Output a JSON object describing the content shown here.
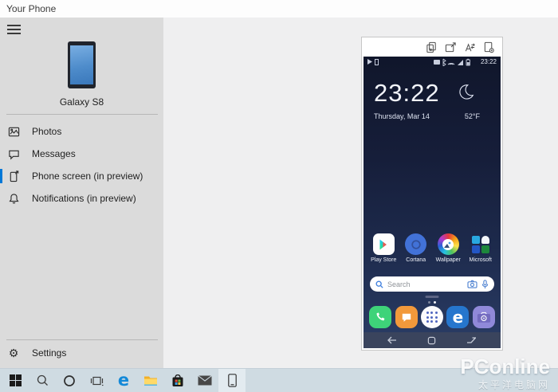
{
  "window": {
    "title": "Your Phone"
  },
  "sidebar": {
    "menu_icon": "hamburger-icon",
    "device": {
      "name": "Galaxy S8"
    },
    "items": [
      {
        "label": "Photos",
        "icon": "photos-icon",
        "selected": false
      },
      {
        "label": "Messages",
        "icon": "messages-icon",
        "selected": false
      },
      {
        "label": "Phone screen (in preview)",
        "icon": "phone-screen-icon",
        "selected": true
      },
      {
        "label": "Notifications (in preview)",
        "icon": "notifications-icon",
        "selected": false
      }
    ],
    "settings": {
      "label": "Settings",
      "icon": "gear-icon"
    }
  },
  "phone_mirror": {
    "toolbar_icons": [
      "copy-screens-icon",
      "open-window-icon",
      "text-input-icon",
      "screenshot-icon"
    ],
    "status_bar": {
      "time": "23:22",
      "left_icons": [
        "play-icon",
        "device-icon"
      ],
      "right_icons": [
        "cast-icon",
        "bluetooth-icon",
        "wifi-icon",
        "signal-icon",
        "battery-icon"
      ]
    },
    "clock_widget": {
      "time": "23:22",
      "date": "Thursday, Mar 14",
      "temperature": "52°F",
      "weather_icon": "crescent-moon-icon"
    },
    "home_apps": [
      {
        "label": "Play Store",
        "icon": "play-store-icon"
      },
      {
        "label": "Cortana",
        "icon": "cortana-icon"
      },
      {
        "label": "Wallpaper",
        "icon": "wallpaper-icon"
      },
      {
        "label": "Microsoft",
        "icon": "microsoft-folder-icon"
      }
    ],
    "search_bar": {
      "placeholder": "Search",
      "icons": [
        "search-icon",
        "camera-icon",
        "mic-icon"
      ]
    },
    "dock_icons": [
      "phone-app-icon",
      "messages-app-icon",
      "apps-drawer-icon",
      "edge-app-icon",
      "camera-app-icon"
    ],
    "nav_icons": [
      "back-icon",
      "home-icon",
      "recents-icon"
    ]
  },
  "taskbar": {
    "icons": [
      "start-icon",
      "search-icon",
      "cortana-icon",
      "task-view-icon",
      "edge-icon",
      "file-explorer-icon",
      "store-icon",
      "mail-icon",
      "your-phone-icon"
    ],
    "active_item": "your-phone"
  },
  "watermark": {
    "title": "PConline",
    "subtitle": "太平洋电脑网"
  },
  "colors": {
    "accent": "#0078d7",
    "sidebar_bg": "#dbdbdb",
    "main_bg": "#efeff0",
    "taskbar_bg": "#cfdbe2",
    "screen_top": "#10162b",
    "screen_bottom": "#2b3d66",
    "navbar_bg": "#3a445d"
  }
}
